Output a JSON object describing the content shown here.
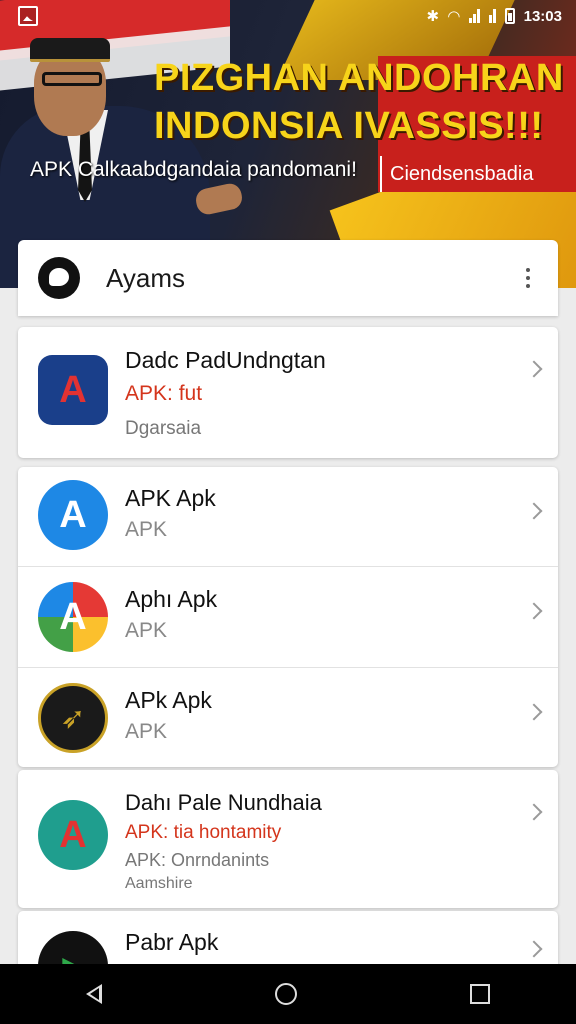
{
  "status_bar": {
    "time": "13:03",
    "icons": [
      "gallery-icon",
      "bluetooth-icon",
      "wifi-icon",
      "signal-icon",
      "signal-icon",
      "battery-icon"
    ]
  },
  "banner": {
    "title_line1": "PIZGHAN ANDOHRAN",
    "title_line2": "INDONSIA IVASSIS!!!",
    "subtitle": "APK Calkaabdgandaia pandomani!",
    "tag": "Ciendsensbadia"
  },
  "header": {
    "title": "Ayams"
  },
  "featured": {
    "title": "Dadc PadUndngtan",
    "subtitle": "APK: fut",
    "meta": "Dgarsaia",
    "icon": "shield-a-icon"
  },
  "apps": [
    {
      "title": "APK Apk",
      "subtitle": "APK",
      "icon": "blue-a-icon"
    },
    {
      "title": "Aphı Apk",
      "subtitle": "APK",
      "icon": "colorful-a-icon"
    },
    {
      "title": "APk Apk",
      "subtitle": "APK",
      "icon": "rocket-badge-icon"
    }
  ],
  "featured2": {
    "title": "Dahı Pale Nundhaia",
    "subtitle": "APK: tia hontamity",
    "meta": "APK: Onrndanints",
    "meta2": "Aamshire",
    "icon": "teal-a-icon"
  },
  "last_app": {
    "title": "Pabr Apk",
    "icon": "green-play-icon"
  },
  "colors": {
    "accent_red": "#d4351c",
    "title_yellow": "#f7d41a",
    "grey_text": "#888888"
  }
}
